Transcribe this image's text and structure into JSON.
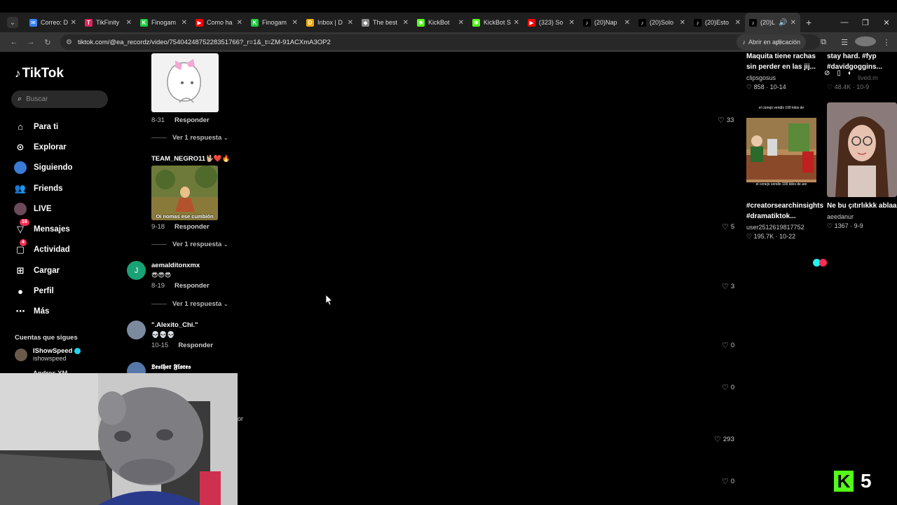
{
  "browser": {
    "tabs": [
      {
        "title": "Correo: D",
        "color": "#3b82f6",
        "glyph": "✉"
      },
      {
        "title": "TikFinity",
        "color": "#e0245e",
        "glyph": "T"
      },
      {
        "title": "Finogam",
        "color": "#1ec840",
        "glyph": "K"
      },
      {
        "title": "Como ha",
        "color": "#ff0000",
        "glyph": "▶"
      },
      {
        "title": "Finogam",
        "color": "#1ec840",
        "glyph": "K"
      },
      {
        "title": "Inbox | D",
        "color": "#f2a900",
        "glyph": "D"
      },
      {
        "title": "The best",
        "color": "#888888",
        "glyph": "◆"
      },
      {
        "title": "KickBot",
        "color": "#53fc18",
        "glyph": "✱"
      },
      {
        "title": "KickBot S",
        "color": "#53fc18",
        "glyph": "✱"
      },
      {
        "title": "(323) So",
        "color": "#ff0000",
        "glyph": "▶"
      },
      {
        "title": "(20)Nap",
        "color": "#000000",
        "glyph": "♪"
      },
      {
        "title": "(20)Solo",
        "color": "#000000",
        "glyph": "♪"
      },
      {
        "title": "(20)Esto",
        "color": "#000000",
        "glyph": "♪"
      },
      {
        "title": "(20)L",
        "color": "#000000",
        "glyph": "♪",
        "active": true
      }
    ],
    "url": "tiktok.com/@ea_recordz/video/754042487522835176​6?_r=1&_t=ZM-91ACXmA3OP2",
    "open_app_label": "Abrir en aplicación"
  },
  "sidebar": {
    "logo_text": "TikTok",
    "search_placeholder": "Buscar",
    "nav": [
      {
        "label": "Para ti",
        "icon": "home-icon"
      },
      {
        "label": "Explorar",
        "icon": "compass-icon"
      },
      {
        "label": "Siguiendo",
        "icon": "following-icon"
      },
      {
        "label": "Friends",
        "icon": "friends-icon"
      },
      {
        "label": "LIVE",
        "icon": "live-icon"
      },
      {
        "label": "Mensajes",
        "icon": "messages-icon",
        "badge": "16"
      },
      {
        "label": "Actividad",
        "icon": "activity-icon",
        "badge": "4"
      },
      {
        "label": "Cargar",
        "icon": "upload-icon"
      },
      {
        "label": "Perfil",
        "icon": "profile-icon"
      },
      {
        "label": "Más",
        "icon": "more-icon"
      }
    ],
    "following_title": "Cuentas que sigues",
    "following": [
      {
        "name": "IShowSpeed",
        "handle": "ishowspeed"
      }
    ],
    "partial_name": "Andres YM"
  },
  "comments": {
    "c1_meta_date": "8-31",
    "reply_label": "Responder",
    "view_replies": "Ver 1 respuesta",
    "c1_likes": "33",
    "c2_user": "TEAM_NEGRO11🖖🏼❤️🔥",
    "c2_gif_caption": "Oi nomas ese cumbión",
    "c2_date": "9-18",
    "c2_likes": "5",
    "c3_avatar_letter": "J",
    "c3_user": "aemalditonxmx",
    "c3_text": "😎😎😎",
    "c3_date": "8-19",
    "c3_likes": "3",
    "c4_user": "\".Alexito_Chi.\"",
    "c4_text": "💀💀💀",
    "c4_date": "10-15",
    "c4_likes": "0",
    "c5_user": "𝕷𝖊𝖘𝖙𝖍𝖊𝖗 𝕱𝖑𝖔𝖗𝖊𝖘",
    "c5_likes": "0",
    "c6_likes": "293",
    "c7_likes": "0",
    "stray_text": "or"
  },
  "recommended": {
    "v1_title": "Maquita tiene rachas sin perder en las jij...",
    "v1_user": "clipsgosus",
    "v1_likes": "858",
    "v1_date": "10-14",
    "v2_title": "stay hard. #fyp #davidgoggins...",
    "v2_user": "lived.m",
    "v2_likes": "48.4K",
    "v2_date": "10-9",
    "v3_caption_top": "el conejo vendio 100 kilos de",
    "v3_caption_bottom": "el conejo vendio 100 kilos de are",
    "v3_title": "#creatorsearchinsights #dramatiktok...",
    "v3_user": "user2512619817752",
    "v3_likes": "195.7K",
    "v3_date": "10-22",
    "v4_title": "Ne bu çıtırlıkkk ablaa",
    "v4_user": "aeedanur",
    "v4_likes": "1367",
    "v4_date": "9-9"
  },
  "overlay": {
    "kick_letter": "K",
    "kick_count": "5"
  }
}
